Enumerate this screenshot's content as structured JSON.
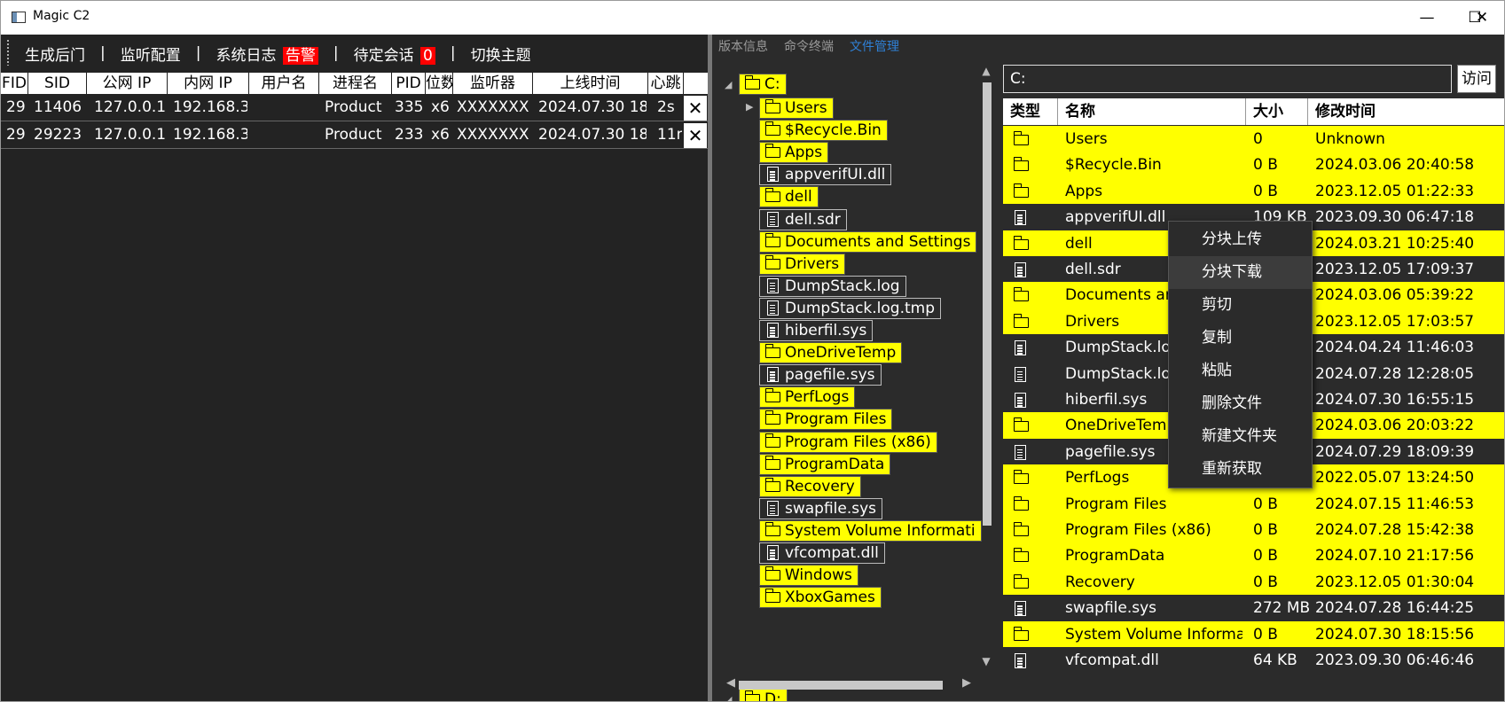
{
  "window": {
    "title": "Magic C2",
    "minimize": "—",
    "maximize": "☐",
    "close": "✕"
  },
  "menu": {
    "items": [
      "生成后门",
      "监听配置",
      "系统日志",
      "待定会话",
      "切换主题"
    ],
    "sep": "|",
    "alert_label": "告警",
    "pending_count": "0"
  },
  "sessions": {
    "columns": [
      "FID",
      "SID",
      "公网 IP",
      "内网 IP",
      "用户名",
      "进程名",
      "PID",
      "位数",
      "监听器",
      "上线时间",
      "心跳"
    ],
    "rows": [
      {
        "fid": "29",
        "sid": "11406",
        "public_ip": "127.0.0.1",
        "internal_ip": "192.168.3",
        "user": "",
        "process": "Product",
        "pid": "335",
        "arch": "x6",
        "listener": "XXXXXXX",
        "online": "2024.07.30 18",
        "heartbeat": "2s"
      },
      {
        "fid": "29",
        "sid": "29223",
        "public_ip": "127.0.0.1",
        "internal_ip": "192.168.3",
        "user": "",
        "process": "Product",
        "pid": "233",
        "arch": "x6",
        "listener": "XXXXXXX",
        "online": "2024.07.30 18",
        "heartbeat": "11n"
      }
    ],
    "close_label": "✕"
  },
  "tabs": [
    "版本信息",
    "命令终端",
    "文件管理"
  ],
  "tree": {
    "root": "C:",
    "items": [
      {
        "name": "Users",
        "type": "folder"
      },
      {
        "name": "$Recycle.Bin",
        "type": "folder"
      },
      {
        "name": "Apps",
        "type": "folder"
      },
      {
        "name": "appverifUI.dll",
        "type": "file"
      },
      {
        "name": "dell",
        "type": "folder"
      },
      {
        "name": "dell.sdr",
        "type": "file"
      },
      {
        "name": "Documents and Settings",
        "type": "folder"
      },
      {
        "name": "Drivers",
        "type": "folder"
      },
      {
        "name": "DumpStack.log",
        "type": "file"
      },
      {
        "name": "DumpStack.log.tmp",
        "type": "file"
      },
      {
        "name": "hiberfil.sys",
        "type": "file"
      },
      {
        "name": "OneDriveTemp",
        "type": "folder"
      },
      {
        "name": "pagefile.sys",
        "type": "file"
      },
      {
        "name": "PerfLogs",
        "type": "folder"
      },
      {
        "name": "Program Files",
        "type": "folder"
      },
      {
        "name": "Program Files (x86)",
        "type": "folder"
      },
      {
        "name": "ProgramData",
        "type": "folder"
      },
      {
        "name": "Recovery",
        "type": "folder"
      },
      {
        "name": "swapfile.sys",
        "type": "file"
      },
      {
        "name": "System Volume Informati",
        "type": "folder"
      },
      {
        "name": "vfcompat.dll",
        "type": "file"
      },
      {
        "name": "Windows",
        "type": "folder"
      },
      {
        "name": "XboxGames",
        "type": "folder"
      }
    ],
    "second_root": "D:"
  },
  "path": {
    "value": "C:",
    "visit_label": "访问"
  },
  "files": {
    "columns": [
      "类型",
      "名称",
      "大小",
      "修改时间"
    ],
    "rows": [
      {
        "type": "folder",
        "name": "Users",
        "size": "0",
        "mtime": "Unknown"
      },
      {
        "type": "folder",
        "name": "$Recycle.Bin",
        "size": "0 B",
        "mtime": "2024.03.06 20:40:58"
      },
      {
        "type": "folder",
        "name": "Apps",
        "size": "0 B",
        "mtime": "2023.12.05 01:22:33"
      },
      {
        "type": "file",
        "name": "appverifUI.dll",
        "size": "109 KB",
        "mtime": "2023.09.30 06:47:18"
      },
      {
        "type": "folder",
        "name": "dell",
        "size": "0 B",
        "mtime": "2024.03.21 10:25:40"
      },
      {
        "type": "file",
        "name": "dell.sdr",
        "size": "",
        "mtime": "2023.12.05 17:09:37"
      },
      {
        "type": "folder",
        "name": "Documents and Settings",
        "size": "",
        "mtime": "2024.03.06 05:39:22"
      },
      {
        "type": "folder",
        "name": "Drivers",
        "size": "",
        "mtime": "2023.12.05 17:03:57"
      },
      {
        "type": "file",
        "name": "DumpStack.log",
        "size": "",
        "mtime": "2024.04.24 11:46:03"
      },
      {
        "type": "file",
        "name": "DumpStack.log.tmp",
        "size": "",
        "mtime": "2024.07.28 12:28:05"
      },
      {
        "type": "file",
        "name": "hiberfil.sys",
        "size": "",
        "mtime": "2024.07.30 16:55:15"
      },
      {
        "type": "folder",
        "name": "OneDriveTemp",
        "size": "",
        "mtime": "2024.03.06 20:03:22"
      },
      {
        "type": "file",
        "name": "pagefile.sys",
        "size": "",
        "mtime": "2024.07.29 18:09:39"
      },
      {
        "type": "folder",
        "name": "PerfLogs",
        "size": "0 B",
        "mtime": "2022.05.07 13:24:50"
      },
      {
        "type": "folder",
        "name": "Program Files",
        "size": "0 B",
        "mtime": "2024.07.15 11:46:53"
      },
      {
        "type": "folder",
        "name": "Program Files (x86)",
        "size": "0 B",
        "mtime": "2024.07.28 15:42:38"
      },
      {
        "type": "folder",
        "name": "ProgramData",
        "size": "0 B",
        "mtime": "2024.07.10 21:17:56"
      },
      {
        "type": "folder",
        "name": "Recovery",
        "size": "0 B",
        "mtime": "2023.12.05 01:30:04"
      },
      {
        "type": "file",
        "name": "swapfile.sys",
        "size": "272 MB",
        "mtime": "2024.07.28 16:44:25"
      },
      {
        "type": "folder",
        "name": "System Volume Informa",
        "size": "0 B",
        "mtime": "2024.07.30 18:15:56"
      },
      {
        "type": "file",
        "name": "vfcompat.dll",
        "size": "64 KB",
        "mtime": "2023.09.30 06:46:46"
      }
    ]
  },
  "context_menu": {
    "items": [
      "分块上传",
      "分块下载",
      "剪切",
      "复制",
      "粘贴",
      "删除文件",
      "新建文件夹",
      "重新获取"
    ],
    "hover_index": 1
  },
  "colors": {
    "folder_bg": "#ffff00",
    "alert": "#ff0000",
    "active_tab": "#2f80d6",
    "panel_bg": "#2b2b2b"
  }
}
